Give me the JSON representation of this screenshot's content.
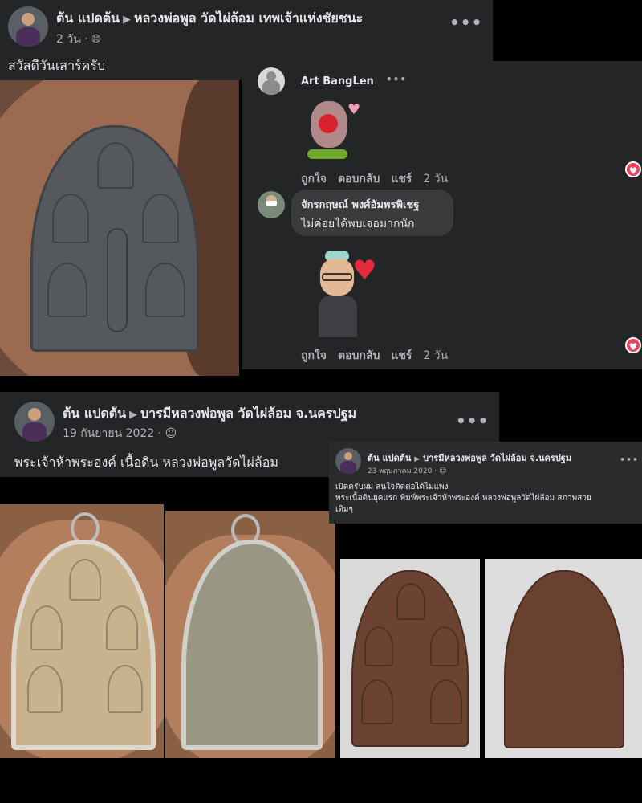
{
  "post1": {
    "author": "ต้น แปดต้น",
    "group": "หลวงพ่อพูล วัดไผ่ล้อม เทพเจ้าแห่งชัยชนะ",
    "time": "2 วัน",
    "text": "สวัสดีวันเสาร์ครับ"
  },
  "comments": {
    "c1_author": "Art BangLen",
    "c1_like": "ถูกใจ",
    "c1_reply": "ตอบกลับ",
    "c1_share": "แชร์",
    "c1_time": "2 วัน",
    "c2_author": "จักรกฤษณ์ พงศ์อัมพรพิเชฐ",
    "c2_text": "ไม่ค่อยได้พบเจอมากนัก",
    "c3_like": "ถูกใจ",
    "c3_reply": "ตอบกลับ",
    "c3_share": "แชร์",
    "c3_time": "2 วัน"
  },
  "post2": {
    "author": "ต้น แปดต้น",
    "group": "บารมีหลวงพ่อพูล วัดไผ่ล้อม จ.นครปฐม",
    "time": "19 กันยายน 2022",
    "text": "พระเจ้าห้าพระองค์ เนื้อดิน หลวงพ่อพูลวัดไผ่ล้อม"
  },
  "post3": {
    "author": "ต้น แปดต้น",
    "group": "บารมีหลวงพ่อพูล วัดไผ่ล้อม จ.นครปฐม",
    "time": "23 พฤษภาคม 2020",
    "line1": "เปิดครับผม สนใจติดต่อได้ไม่แพง",
    "line2": "พระเนื้อดินยุคแรก พิมพ์พระเจ้าห้าพระองค์  หลวงพ่อพูลวัดไผ่ล้อม สภาพสวย",
    "line3": "เดิมๆ"
  },
  "icons": {
    "globe": "globe-icon",
    "friends": "friends-icon",
    "more": "more-options-icon",
    "heart": "heart-reaction-icon"
  },
  "colors": {
    "panel": "#242526",
    "text": "#e4e6eb",
    "muted": "#b0b3b8",
    "bubble": "#3a3b3c",
    "heart": "#f33e58"
  }
}
